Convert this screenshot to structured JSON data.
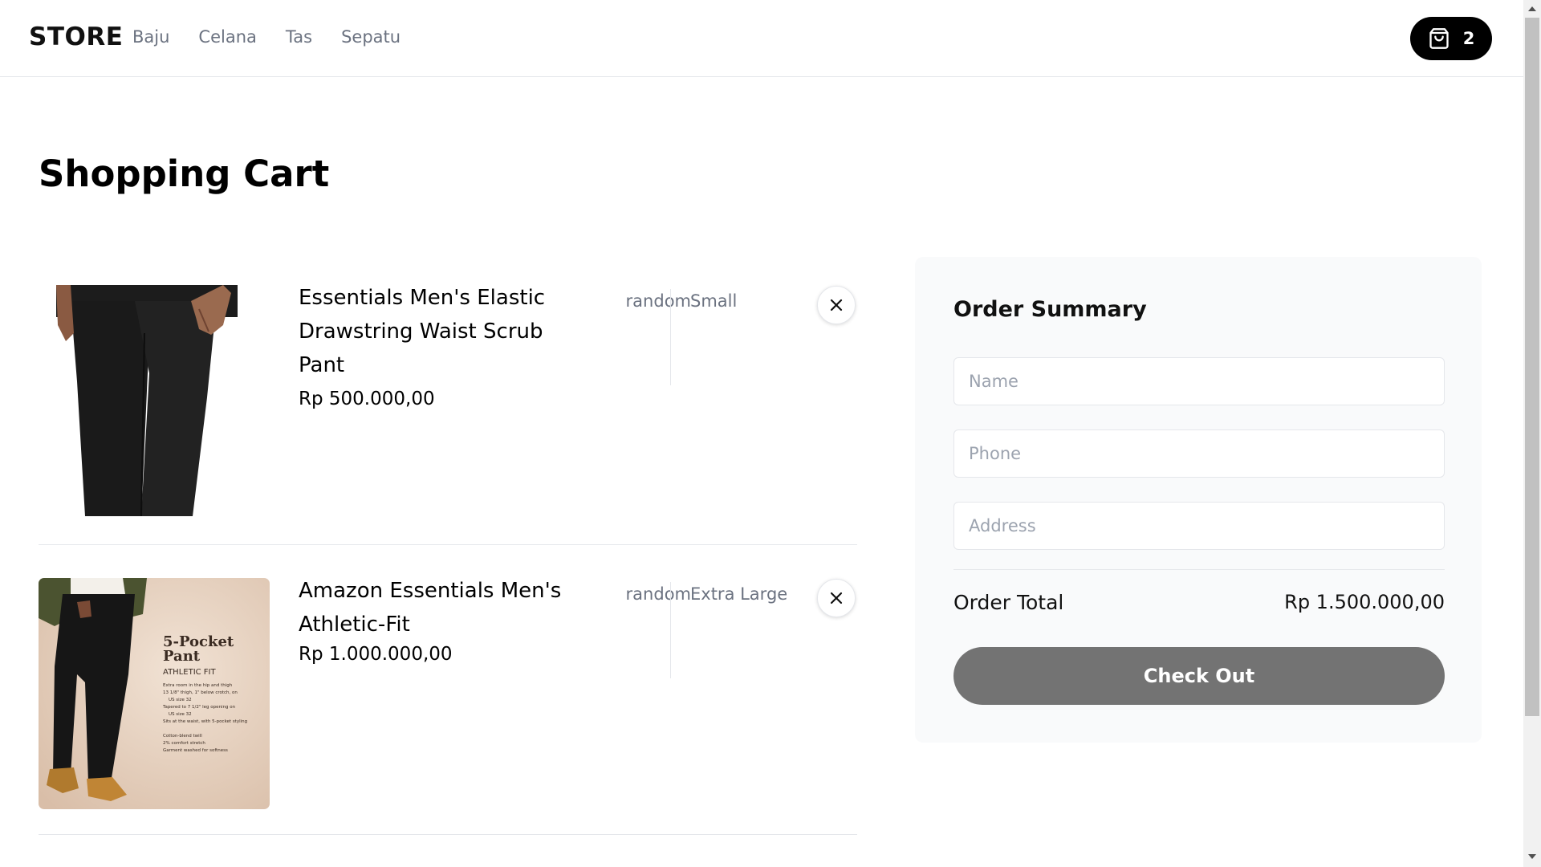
{
  "header": {
    "logo": "STORE",
    "nav": [
      "Baju",
      "Celana",
      "Tas",
      "Sepatu"
    ],
    "cart_count": "2",
    "cart_icon": "shopping-bag-icon"
  },
  "page_title": "Shopping Cart",
  "items": [
    {
      "name": "Essentials Men's Elastic Drawstring Waist Scrub Pant",
      "price": "Rp 500.000,00",
      "color": "random",
      "size": "Small",
      "image": "black-scrub-pant-photo"
    },
    {
      "name": "Amazon Essentials Men's Athletic-Fit",
      "price": "Rp 1.000.000,00",
      "color": "random",
      "size": "Extra Large",
      "image": "black-5-pocket-pant-photo",
      "image_text": {
        "title_line1": "5-Pocket",
        "title_line2": "Pant",
        "subtitle": "ATHLETIC FIT",
        "details": [
          "Extra room in the hip and thigh",
          "13 1/8\" thigh, 1\" below crotch, on",
          "US size 32",
          "Tapered to 7 1/2\" leg opening on",
          "US size 32",
          "Sits at the waist, with 5-pocket styling",
          "",
          "Cotton-blend twill",
          "2% comfort stretch",
          "Garment washed for softness"
        ]
      }
    }
  ],
  "summary": {
    "title": "Order Summary",
    "name_placeholder": "Name",
    "phone_placeholder": "Phone",
    "address_placeholder": "Address",
    "total_label": "Order Total",
    "total_value": "Rp 1.500.000,00",
    "checkout_label": "Check Out"
  },
  "colors": {
    "checkout_button": "#737373",
    "cart_button": "#000000",
    "summary_bg": "#f9fafb",
    "muted_text": "#6b7280"
  }
}
